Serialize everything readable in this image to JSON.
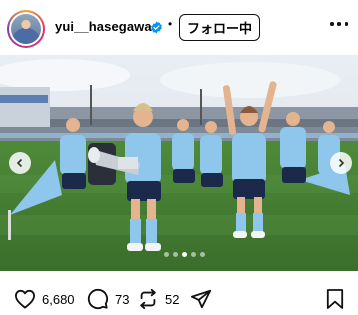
{
  "header": {
    "username": "yui__hasegawa",
    "follow_label": "フォロー中",
    "separator": "•"
  },
  "carousel": {
    "total_slides": 5,
    "active_slide": 3
  },
  "actions": {
    "likes": "6,680",
    "comments": "73",
    "shares": "52"
  },
  "colors": {
    "verified": "#0095f6",
    "sky_blue_kit": "#8fc6ec",
    "navy_shorts": "#1b2a4a"
  },
  "icons": {
    "like": "heart-icon",
    "comment": "comment-icon",
    "share": "repost-icon",
    "send": "send-icon",
    "save": "bookmark-icon",
    "more": "more-icon",
    "verified": "verified-badge-icon",
    "prev": "chevron-left-icon",
    "next": "chevron-right-icon"
  }
}
